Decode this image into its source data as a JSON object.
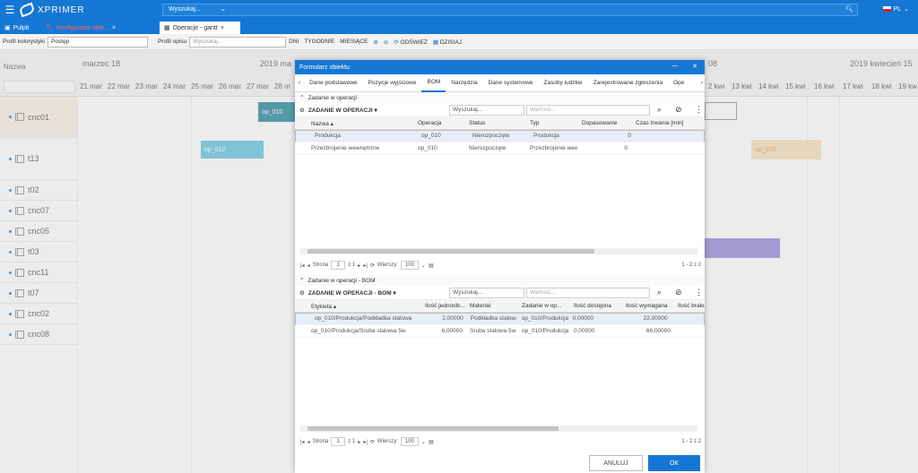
{
  "app": {
    "brand": "XPRIMER",
    "search_placeholder": "Wyszukaj...",
    "lang": "PL"
  },
  "tabs": [
    {
      "label": "Pulpit"
    },
    {
      "label": "Konfigurator obie..."
    },
    {
      "label": "Operacje - gantt"
    }
  ],
  "toolbar": {
    "profile_label": "Profil kolorystyki",
    "profile_value": "Postęp",
    "profile2_label": "Profil opisu",
    "profile2_value": "Wyszukaj...",
    "dni": "DNI",
    "tygodnie": "TYGODNIE",
    "miesiace": "MIESIĄCE",
    "odswiez": "ODŚWIEŻ",
    "dzisiaj": "DZISIAJ"
  },
  "gantt": {
    "name_header": "Nazwa",
    "months": [
      {
        "label": "marzec 18"
      },
      {
        "label": "2019 ma"
      },
      {
        "label": "08"
      },
      {
        "label": "2019 kwiecień 15"
      }
    ],
    "days": [
      "21 mar",
      "22 mar",
      "23 mar",
      "24 mar",
      "25 mar",
      "26 mar",
      "27 mar",
      "28 m",
      "2 kwi",
      "13 kwi",
      "14 kwi",
      "15 kwi",
      "16 kwi",
      "17 kwi",
      "18 kwi",
      "19 kw"
    ],
    "rows": [
      {
        "name": "cnc01"
      },
      {
        "name": "t13"
      },
      {
        "name": "t02"
      },
      {
        "name": "cnc07"
      },
      {
        "name": "cnc05"
      },
      {
        "name": "t03"
      },
      {
        "name": "cnc11"
      },
      {
        "name": "t07"
      },
      {
        "name": "cnc02"
      },
      {
        "name": "cnc08"
      }
    ],
    "bars": [
      {
        "label": "op_010",
        "color": "#1a7f94"
      },
      {
        "label": "op_012",
        "color": "#5bc0de"
      },
      {
        "label": "op_029",
        "color": "#f6ddb9",
        "text_color": "#e69a3a"
      },
      {
        "label": "",
        "color": "#8e82d6"
      }
    ]
  },
  "modal": {
    "title": "Formularz obiektu",
    "tabs": [
      "Dane podstawowe",
      "Pozycje wyjściowe",
      "BOM",
      "Narzędzia",
      "Dane systemowe",
      "Zasoby ludzkie",
      "Zarejestrowane zgłoszenia",
      "Ope"
    ],
    "active_tab": "BOM",
    "sec1": {
      "title": "Zadanie w operacji",
      "grid_label": "ZADANIE W OPERACJI",
      "filter_select": "Wyszukaj...",
      "filter_value": "Wartość...",
      "columns": [
        "Nazwa",
        "Operacja",
        "Status",
        "Typ",
        "Dopasowanie",
        "Czas trwania [min]"
      ],
      "rows": [
        [
          "Produkcja",
          "op_010",
          "Nierozpoczęte",
          "Produkcja",
          "0",
          ""
        ],
        [
          "Przezbrojenie wewnętrzne",
          "op_010",
          "Nierozpoczęte",
          "Przezbrojenie wew",
          "0",
          ""
        ]
      ],
      "pager": {
        "strona": "Strona",
        "page": "1",
        "z": "z 1",
        "wiersze": "Wierszy:",
        "rows_per_page": "100",
        "total": "1 - 2 z 2"
      }
    },
    "sec2": {
      "title": "Zadanie w operacji - BOM",
      "grid_label": "ZADANIE W OPERACJI - BOM",
      "filter_select": "Wyszukaj...",
      "filter_value": "Wartość...",
      "columns": [
        "Etykieta",
        "Ilość jednostk...",
        "Materiał",
        "Zadanie w op...",
        "Ilość dostępna",
        "Ilość wymagana",
        "Ilość braku"
      ],
      "rows": [
        [
          "op_010/Produkcja/Podkładka stalowa",
          "2,00000",
          "Podkładka stalow.",
          "op_010/Produkcja",
          "0,00000",
          "22,00000",
          ""
        ],
        [
          "op_010/Produkcja/Śruba stalowa 5w",
          "6,00000",
          "Śruba stalowa 5w",
          "op_010/Produkcja",
          "0,00000",
          "66,00000",
          ""
        ]
      ],
      "pager": {
        "strona": "Strona",
        "page": "1",
        "z": "z 1",
        "wiersze": "Wierszy:",
        "rows_per_page": "100",
        "total": "1 - 2 z 2"
      }
    },
    "cancel": "ANULUJ",
    "ok": "OK"
  }
}
